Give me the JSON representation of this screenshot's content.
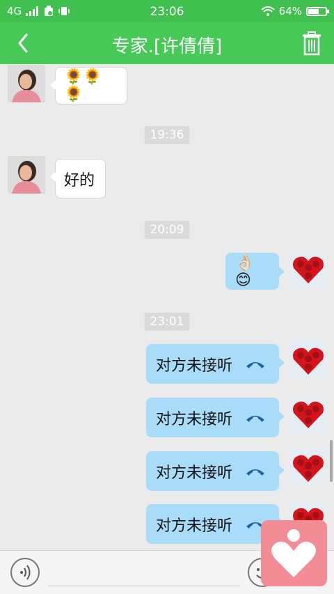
{
  "status_bar": {
    "network": "4G",
    "time": "23:06",
    "battery_percent": "64%",
    "battery_level": 0.64
  },
  "header": {
    "title": "专家.[许倩倩]"
  },
  "messages": {
    "m1": {
      "side": "left",
      "content": "🌻🌻🌻"
    },
    "t1": "19:36",
    "m2": {
      "side": "left",
      "content": "好的"
    },
    "t2": "20:09",
    "m3": {
      "side": "right",
      "content": "👌🏻😊"
    },
    "t3": "23:01",
    "m4": {
      "side": "right",
      "content": "对方未接听"
    },
    "m5": {
      "side": "right",
      "content": "对方未接听"
    },
    "m6": {
      "side": "right",
      "content": "对方未接听"
    },
    "m7": {
      "side": "right",
      "content": "对方未接听"
    }
  },
  "icons": {
    "back": "chevron-left-icon",
    "delete": "trash-icon",
    "voice": "voice-icon",
    "emoji": "emoji-icon",
    "call": "phone-hangup-icon",
    "floating": "heart-person-icon"
  },
  "colors": {
    "status_bar": "#3fc04f",
    "nav_bar": "#47c957",
    "right_bubble": "#a8dcf9",
    "left_bubble": "#ffffff",
    "chat_background": "#ebebeb",
    "call_icon": "#1f5fa0",
    "floating_button": "#f28c95"
  }
}
